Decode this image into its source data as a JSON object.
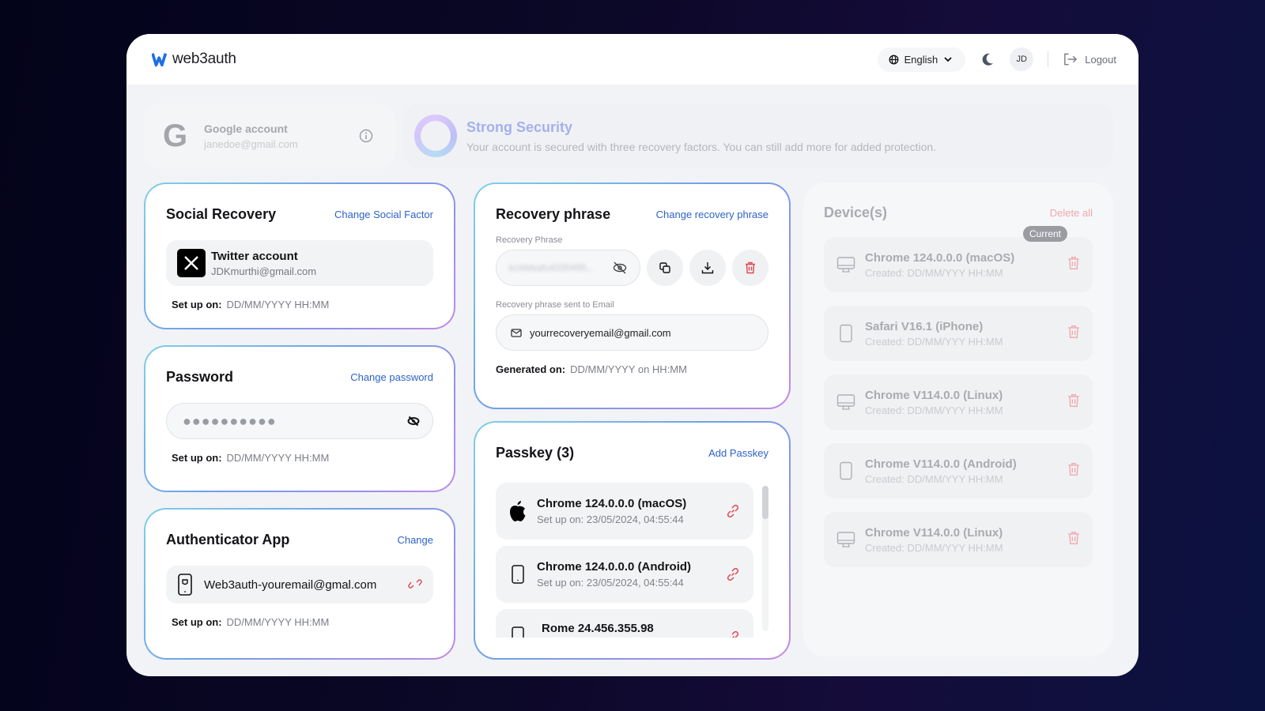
{
  "header": {
    "brand": "web3auth",
    "language": "English",
    "avatar_initials": "JD",
    "logout_label": "Logout"
  },
  "account": {
    "provider_title": "Google account",
    "email": "janedoe@gmail.com"
  },
  "security": {
    "title": "Strong Security",
    "description": "Your account is secured with three recovery factors. You can still add more for added protection."
  },
  "social_recovery": {
    "title": "Social Recovery",
    "action": "Change Social Factor",
    "account_title": "Twitter account",
    "account_email": "JDKmurthi@gmail.com",
    "setup_label": "Set up on:",
    "setup_value": "DD/MM/YYYY HH:MM"
  },
  "password": {
    "title": "Password",
    "action": "Change password",
    "masked_value": "●●●●●●●●●●",
    "setup_label": "Set up on:",
    "setup_value": "DD/MM/YYYY HH:MM"
  },
  "authenticator": {
    "title": "Authenticator App",
    "action": "Change",
    "account": "Web3auth-youremail@gmal.com",
    "setup_label": "Set up on:",
    "setup_value": "DD/MM/YYYY HH:MM"
  },
  "recovery_phrase": {
    "title": "Recovery phrase",
    "action": "Change recovery phrase",
    "phrase_label": "Recovery Phrase",
    "phrase_hidden": "kchfdsafu4330495...",
    "email_label": "Recovery phrase sent to Email",
    "email_value": "yourrecoveryemail@gmail.com",
    "generated_label": "Generated on:",
    "generated_value": "DD/MM/YYYY on HH:MM"
  },
  "passkeys": {
    "title": "Passkey (3)",
    "action": "Add Passkey",
    "items": [
      {
        "name": "Chrome 124.0.0.0 (macOS)",
        "setup": "Set up on: 23/05/2024, 04:55:44",
        "icon": "apple-icon"
      },
      {
        "name": "Chrome 124.0.0.0 (Android)",
        "setup": "Set up on: 23/05/2024, 04:55:44",
        "icon": "phone-icon"
      },
      {
        "name": "Rome 24.456.355.98",
        "setup": "",
        "icon": "phone-icon"
      }
    ]
  },
  "devices": {
    "title": "Device(s)",
    "delete_all": "Delete all",
    "current_badge": "Current",
    "items": [
      {
        "name": "Chrome 124.0.0.0 (macOS)",
        "created": "Created: DD/MM/YYY HH:MM",
        "type": "desktop"
      },
      {
        "name": "Safari V16.1 (iPhone)",
        "created": "Created: DD/MM/YYY HH:MM",
        "type": "phone"
      },
      {
        "name": "Chrome V114.0.0 (Linux)",
        "created": "Created: DD/MM/YYY HH:MM",
        "type": "desktop"
      },
      {
        "name": "Chrome V114.0.0 (Android)",
        "created": "Created: DD/MM/YYY HH:MM",
        "type": "phone"
      },
      {
        "name": "Chrome V114.0.0 (Linux)",
        "created": "Created: DD/MM/YYY HH:MM",
        "type": "desktop"
      }
    ]
  },
  "colors": {
    "accent_link": "#2e62c9",
    "danger": "#e0454f",
    "brand_blue": "#1f6fe5"
  }
}
